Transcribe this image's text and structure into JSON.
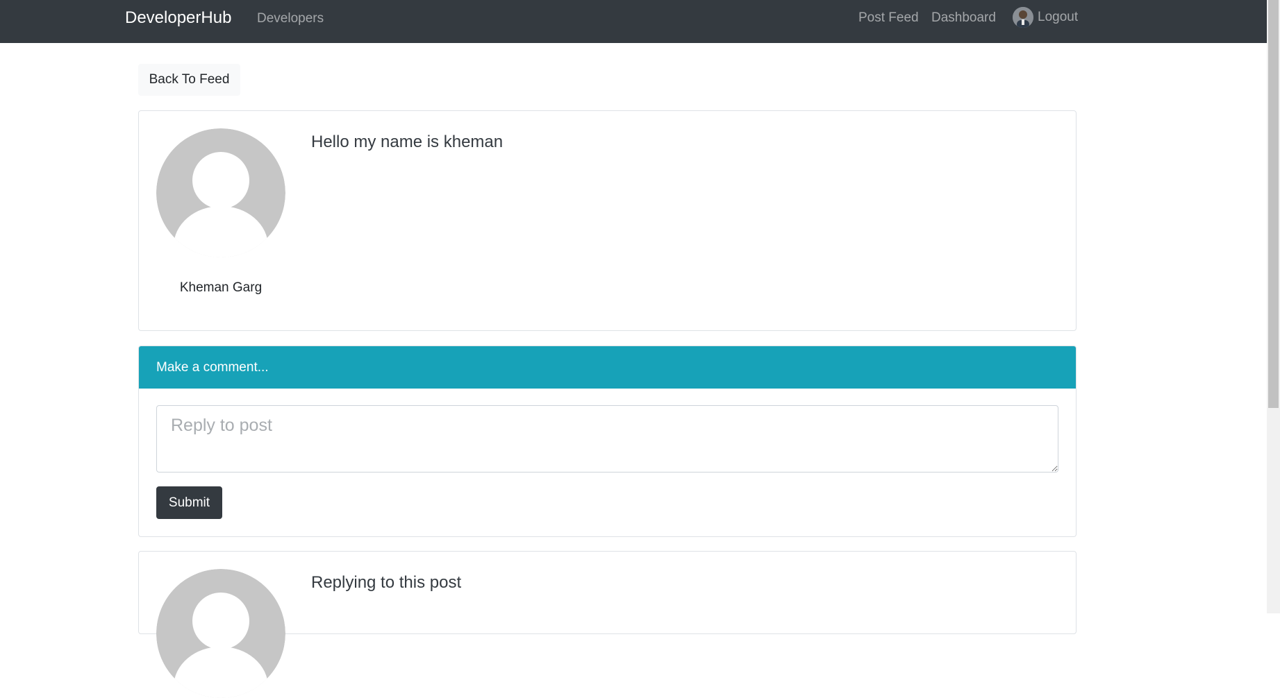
{
  "navbar": {
    "brand": "DeveloperHub",
    "developers": "Developers",
    "post_feed": "Post Feed",
    "dashboard": "Dashboard",
    "logout": "Logout"
  },
  "back_button": "Back To Feed",
  "post": {
    "author": "Kheman Garg",
    "text": "Hello my name is kheman"
  },
  "comment_form": {
    "header": "Make a comment...",
    "placeholder": "Reply to post",
    "submit": "Submit"
  },
  "reply": {
    "text": "Replying to this post"
  },
  "colors": {
    "navbar": "#343a40",
    "header_accent": "#17a2b8",
    "avatar_placeholder": "#c6c6c6"
  }
}
